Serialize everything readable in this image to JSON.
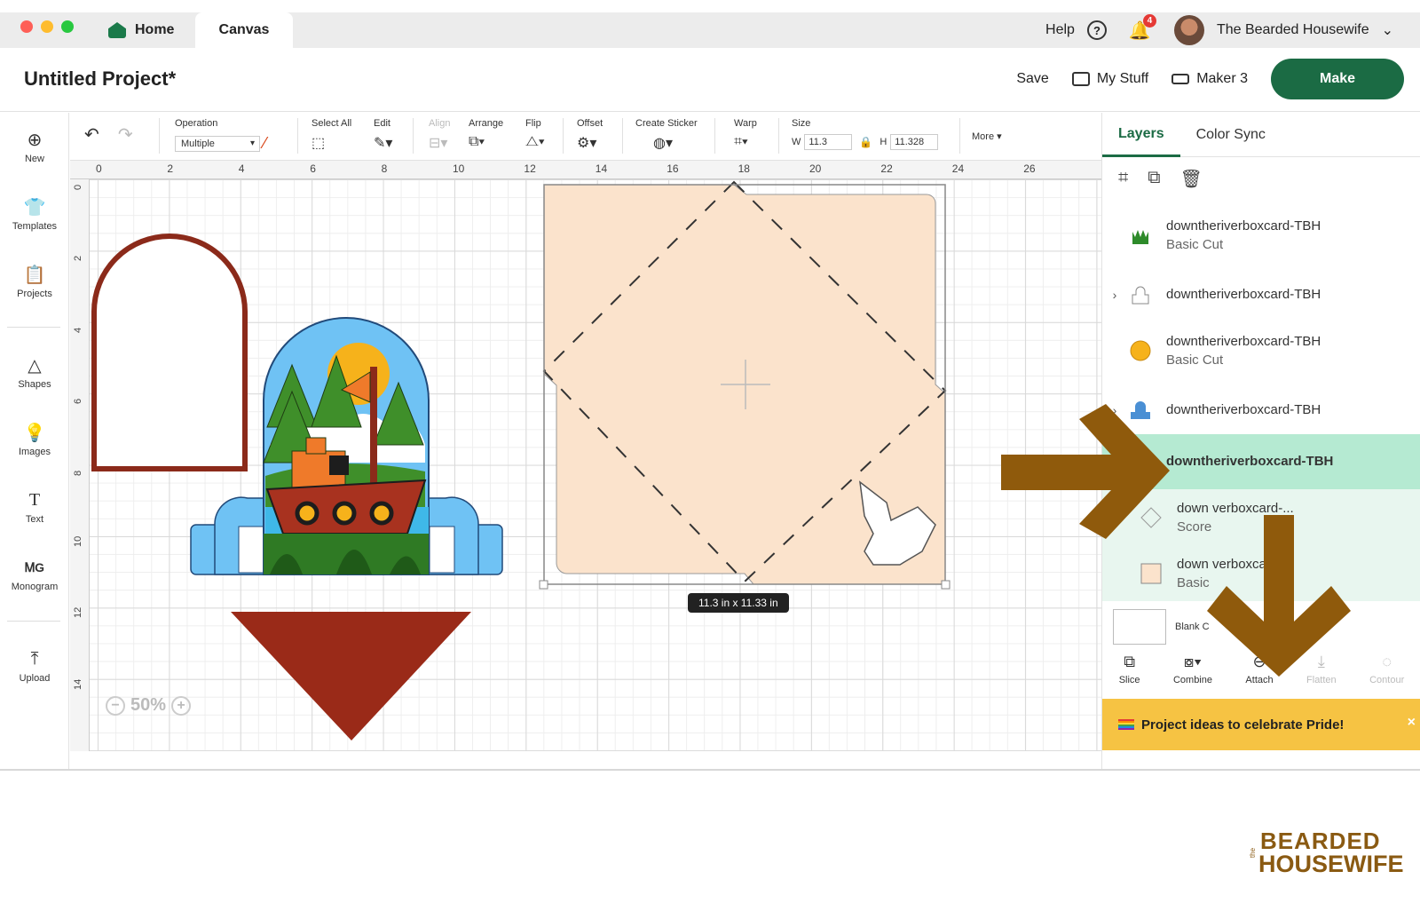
{
  "titlebar": {
    "tab_home": "Home",
    "tab_canvas": "Canvas",
    "help": "Help",
    "notif_count": "4",
    "user_name": "The Bearded Housewife"
  },
  "project": {
    "title": "Untitled Project*",
    "save": "Save",
    "my_stuff": "My Stuff",
    "machine": "Maker 3",
    "make": "Make"
  },
  "leftbar": {
    "items": [
      {
        "label": "New",
        "icon": "plus-circle-icon"
      },
      {
        "label": "Templates",
        "icon": "shirt-icon"
      },
      {
        "label": "Projects",
        "icon": "clipboard-icon"
      },
      {
        "label": "Shapes",
        "icon": "shapes-icon"
      },
      {
        "label": "Images",
        "icon": "lightbulb-icon"
      },
      {
        "label": "Text",
        "icon": "text-t-icon"
      },
      {
        "label": "Monogram",
        "icon": "monogram-icon"
      },
      {
        "label": "Upload",
        "icon": "upload-icon"
      }
    ]
  },
  "toolbar": {
    "operation_label": "Operation",
    "operation_value": "Multiple",
    "select_all": "Select All",
    "edit": "Edit",
    "align": "Align",
    "arrange": "Arrange",
    "flip": "Flip",
    "offset": "Offset",
    "create_sticker": "Create Sticker",
    "warp": "Warp",
    "size": "Size",
    "w_label": "W",
    "w_value": "11.3",
    "h_label": "H",
    "h_value": "11.328",
    "more": "More"
  },
  "canvas": {
    "ruler_x": [
      "0",
      "2",
      "4",
      "6",
      "8",
      "10",
      "12",
      "14",
      "16",
      "18",
      "20",
      "22",
      "24",
      "26"
    ],
    "ruler_y": [
      "0",
      "2",
      "4",
      "6",
      "8",
      "10",
      "12",
      "14"
    ],
    "zoom": "50%",
    "size_tooltip": "11.3  in x 11.33  in"
  },
  "layers_panel": {
    "tab_layers": "Layers",
    "tab_color_sync": "Color Sync",
    "layers": [
      {
        "name": "downtheriverboxcard-TBH",
        "sub": "Basic Cut"
      },
      {
        "name": "downtheriverboxcard-TBH",
        "sub": ""
      },
      {
        "name": "downtheriverboxcard-TBH",
        "sub": "Basic Cut"
      },
      {
        "name": "downtheriverboxcard-TBH",
        "sub": ""
      },
      {
        "name": "downtheriverboxcard-TBH",
        "sub": ""
      },
      {
        "name": "down  verboxcard-...",
        "sub": "Score"
      },
      {
        "name": "down  verboxcard-...",
        "sub": "Basic"
      }
    ],
    "blank_label": "Blank C",
    "actions": [
      {
        "label": "Slice"
      },
      {
        "label": "Combine"
      },
      {
        "label": "Attach"
      },
      {
        "label": "Flatten"
      },
      {
        "label": "Contour"
      }
    ],
    "promo": "Project ideas to celebrate Pride!",
    "promo_close": "×"
  },
  "watermark": {
    "the": "the",
    "line1": "BEARDED",
    "line2": "HOUSEWIFE"
  },
  "colors": {
    "brand_green": "#1b6b44",
    "selected_layer": "#b5ead2",
    "arrow_brown": "#8f5a0c",
    "envelope_peach": "#fbe3cc",
    "promo_yellow": "#f6c343"
  }
}
